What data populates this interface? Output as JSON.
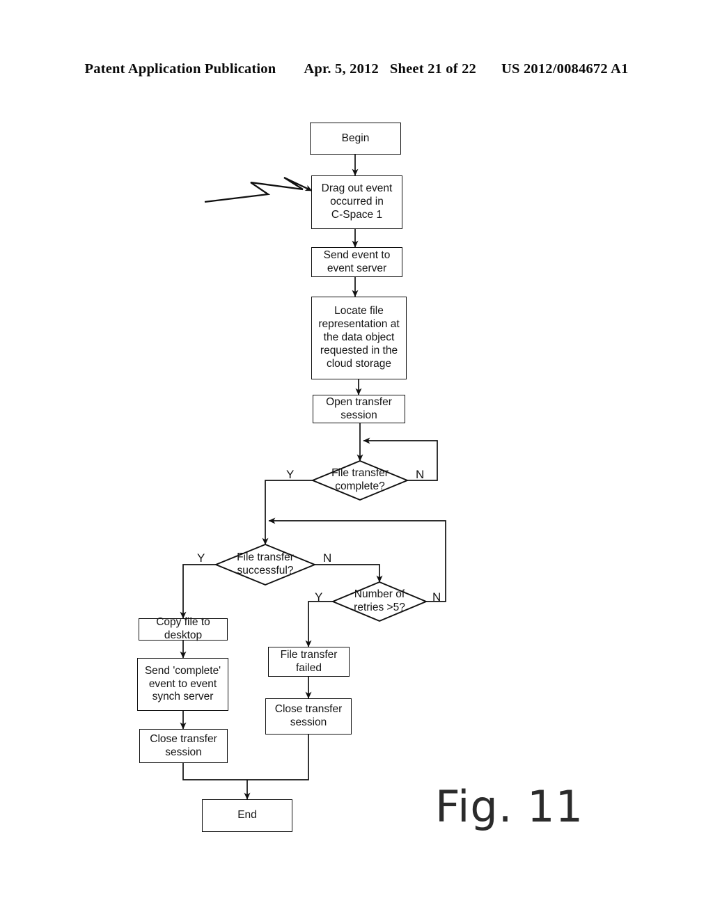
{
  "header": {
    "publication": "Patent Application Publication",
    "date": "Apr. 5, 2012",
    "sheet": "Sheet 21 of 22",
    "patent_number": "US 2012/0084672 A1"
  },
  "figure": {
    "caption": "Fig. 11",
    "nodes": {
      "begin": "Begin",
      "drag_out_event": "Drag out event\noccurred in\nC-Space 1",
      "send_event": "Send event to\nevent server",
      "locate_file": "Locate file\nrepresentation at\nthe data object\nrequested in the\ncloud storage",
      "open_session": "Open transfer\nsession",
      "transfer_complete": "File transfer\ncomplete?",
      "transfer_successful": "File transfer\nsuccessful?",
      "retries": "Number of\nretries >5?",
      "copy_file": "Copy file to\ndesktop",
      "send_complete_event": "Send 'complete'\nevent to event\nsynch server",
      "close_session_left": "Close transfer\nsession",
      "transfer_failed": "File transfer\nfailed",
      "close_session_mid": "Close transfer\nsession",
      "end": "End"
    },
    "branch_labels": {
      "complete_yes": "Y",
      "complete_no": "N",
      "successful_yes": "Y",
      "successful_no": "N",
      "retries_yes": "Y",
      "retries_no": "N"
    },
    "colors": {
      "stroke": "#101010",
      "text": "#141414",
      "background": "#ffffff"
    }
  }
}
